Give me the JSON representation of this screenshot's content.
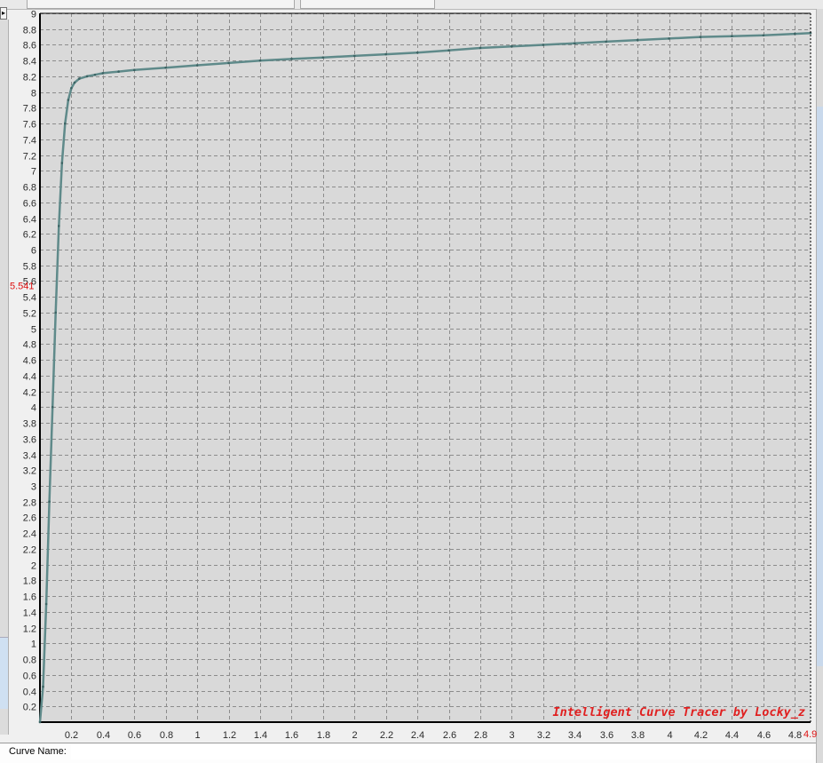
{
  "status": {
    "curve_name_label": "Curve Name:",
    "curve_name_value": ""
  },
  "watermark": "Intelligent Curve Tracer by Locky_z",
  "cursor": {
    "y_readout": "5.541",
    "x_readout": "4.9"
  },
  "colors": {
    "plot_bg": "#d9d9d9",
    "grid": "#8c8c8c",
    "curve": "#5f8a8a",
    "marker": "#3c6464",
    "axis_text": "#2a2a2a",
    "readout": "#dd1111"
  },
  "chart_data": {
    "type": "line",
    "title": "",
    "xlabel": "",
    "ylabel": "",
    "xlim": [
      0,
      4.9
    ],
    "ylim": [
      0,
      9
    ],
    "grid": true,
    "x_ticks": [
      "0.2",
      "0.4",
      "0.6",
      "0.8",
      "1",
      "1.2",
      "1.4",
      "1.6",
      "1.8",
      "2",
      "2.2",
      "2.4",
      "2.6",
      "2.8",
      "3",
      "3.2",
      "3.4",
      "3.6",
      "3.8",
      "4",
      "4.2",
      "4.4",
      "4.6",
      "4.8"
    ],
    "y_ticks": [
      "0.2",
      "0.4",
      "0.6",
      "0.8",
      "1",
      "1.2",
      "1.4",
      "1.6",
      "1.8",
      "2",
      "2.2",
      "2.4",
      "2.6",
      "2.8",
      "3",
      "3.2",
      "3.4",
      "3.6",
      "3.8",
      "4",
      "4.2",
      "4.4",
      "4.6",
      "4.8",
      "5",
      "5.2",
      "5.4",
      "5.6",
      "5.8",
      "6",
      "6.2",
      "6.4",
      "6.6",
      "6.8",
      "7",
      "7.2",
      "7.4",
      "7.6",
      "7.8",
      "8",
      "8.2",
      "8.4",
      "8.6",
      "8.8",
      "9"
    ],
    "series": [
      {
        "x": [
          0,
          0.02,
          0.04,
          0.06,
          0.08,
          0.1,
          0.12,
          0.14,
          0.16,
          0.18,
          0.2,
          0.22,
          0.25,
          0.3,
          0.35,
          0.4,
          0.5,
          0.6,
          0.8,
          1.0,
          1.2,
          1.4,
          1.6,
          1.8,
          2.0,
          2.2,
          2.4,
          2.6,
          2.8,
          3.0,
          3.2,
          3.4,
          3.6,
          3.8,
          4.0,
          4.2,
          4.4,
          4.6,
          4.8,
          4.9
        ],
        "y": [
          0,
          0.45,
          1.5,
          2.8,
          4.0,
          5.2,
          6.3,
          7.1,
          7.6,
          7.9,
          8.05,
          8.12,
          8.17,
          8.2,
          8.22,
          8.24,
          8.26,
          8.28,
          8.31,
          8.34,
          8.37,
          8.4,
          8.42,
          8.44,
          8.46,
          8.48,
          8.5,
          8.53,
          8.56,
          8.58,
          8.6,
          8.62,
          8.64,
          8.66,
          8.68,
          8.7,
          8.71,
          8.72,
          8.74,
          8.75
        ]
      }
    ]
  }
}
